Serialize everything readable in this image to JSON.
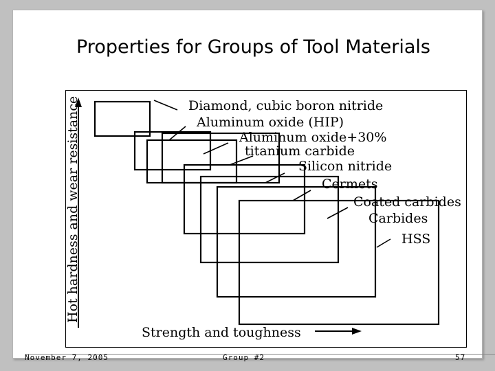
{
  "slide": {
    "title": "Properties for Groups of Tool Materials",
    "footer": {
      "date": "November 7, 2005",
      "center": "Group #2",
      "page": "57"
    }
  },
  "figure": {
    "y_axis_label": "Hot hardness and wear resistance",
    "x_axis_label": "Strength and toughness",
    "labels": [
      "Diamond,  cubic  boron  nitride",
      "Aluminum  oxide  (HIP)",
      "Aluminum  oxide+30%",
      "titanium  carbide",
      "Silicon  nitride",
      "Cermets",
      "Coated  carbides",
      "Carbides",
      "HSS"
    ]
  }
}
